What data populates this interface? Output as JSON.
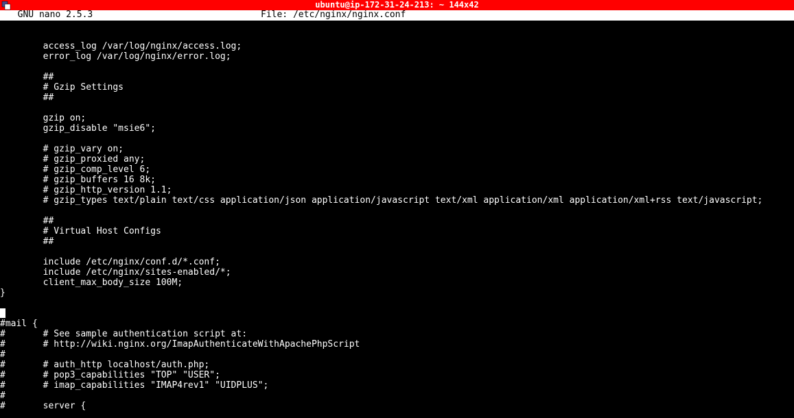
{
  "window": {
    "title": "ubuntu@ip-172-31-24-213: ~ 144x42"
  },
  "nano": {
    "version": "  GNU nano 2.5.3",
    "file_label": "File: /etc/nginx/nginx.conf"
  },
  "lines": [
    "",
    "",
    "        access_log /var/log/nginx/access.log;",
    "        error_log /var/log/nginx/error.log;",
    "",
    "        ##",
    "        # Gzip Settings",
    "        ##",
    "",
    "        gzip on;",
    "        gzip_disable \"msie6\";",
    "",
    "        # gzip_vary on;",
    "        # gzip_proxied any;",
    "        # gzip_comp_level 6;",
    "        # gzip_buffers 16 8k;",
    "        # gzip_http_version 1.1;",
    "        # gzip_types text/plain text/css application/json application/javascript text/xml application/xml application/xml+rss text/javascript;",
    "",
    "        ##",
    "        # Virtual Host Configs",
    "        ##",
    "",
    "        include /etc/nginx/conf.d/*.conf;",
    "        include /etc/nginx/sites-enabled/*;",
    "        client_max_body_size 100M;",
    "}",
    "",
    "CURSOR",
    "#mail {",
    "#       # See sample authentication script at:",
    "#       # http://wiki.nginx.org/ImapAuthenticateWithApachePhpScript",
    "#",
    "#       # auth_http localhost/auth.php;",
    "#       # pop3_capabilities \"TOP\" \"USER\";",
    "#       # imap_capabilities \"IMAP4rev1\" \"UIDPLUS\";",
    "#",
    "#       server {"
  ]
}
